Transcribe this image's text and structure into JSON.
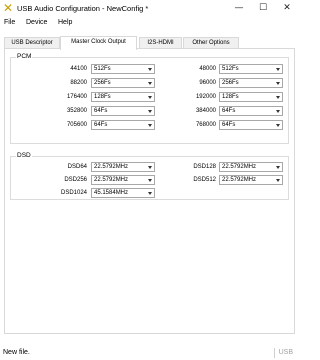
{
  "window": {
    "title": "USB Audio Configuration - NewConfig *",
    "icon": "x-logo-icon",
    "minimize": "—",
    "maximize": "☐",
    "close": "✕"
  },
  "menu": {
    "items": [
      "File",
      "Device",
      "Help"
    ]
  },
  "tabs": [
    {
      "label": "USB Descriptor"
    },
    {
      "label": "Master Clock Output"
    },
    {
      "label": "I2S-HDMI"
    },
    {
      "label": "Other Options"
    }
  ],
  "active_tab": "Master Clock Output",
  "pcm": {
    "title": "PCM",
    "rows": [
      {
        "left_label": "44100",
        "left_value": "512Fs",
        "right_label": "48000",
        "right_value": "512Fs"
      },
      {
        "left_label": "88200",
        "left_value": "256Fs",
        "right_label": "96000",
        "right_value": "256Fs"
      },
      {
        "left_label": "176400",
        "left_value": "128Fs",
        "right_label": "192000",
        "right_value": "128Fs"
      },
      {
        "left_label": "352800",
        "left_value": "64Fs",
        "right_label": "384000",
        "right_value": "64Fs"
      },
      {
        "left_label": "705600",
        "left_value": "64Fs",
        "right_label": "768000",
        "right_value": "64Fs"
      }
    ]
  },
  "dsd": {
    "title": "DSD",
    "rows": [
      {
        "left_label": "DSD64",
        "left_value": "22.5792MHz",
        "right_label": "DSD128",
        "right_value": "22.5792MHz"
      },
      {
        "left_label": "DSD256",
        "left_value": "22.5792MHz",
        "right_label": "DSD512",
        "right_value": "22.5792MHz"
      },
      {
        "left_label": "DSD1024",
        "left_value": "45.1584MHz",
        "right_label": "",
        "right_value": ""
      }
    ]
  },
  "status": {
    "text": "New file.",
    "usb": "USB"
  }
}
